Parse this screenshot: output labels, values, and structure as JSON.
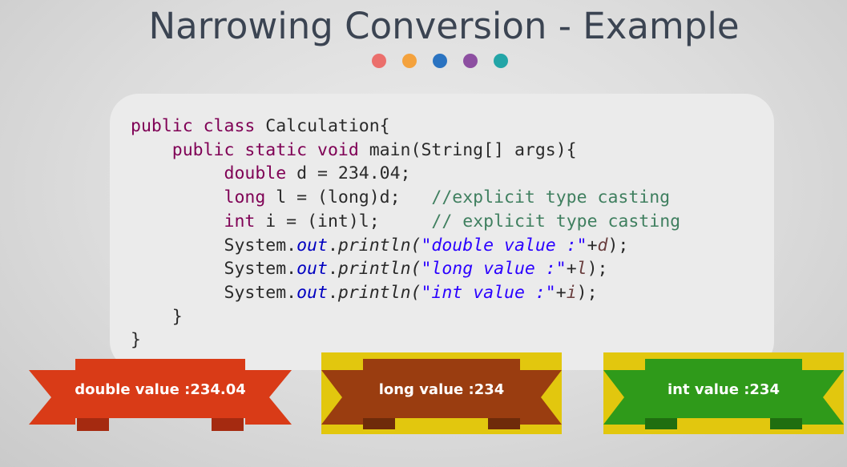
{
  "slide": {
    "title": "Narrowing Conversion - Example",
    "dot_colors": [
      "#eb6f6c",
      "#f4a23d",
      "#2a73c1",
      "#8d4fa1",
      "#23a5a7"
    ]
  },
  "code": {
    "line1": {
      "kw": "public class",
      "rest": " Calculation{"
    },
    "line2": {
      "kw": "public static void",
      "rest": " main(String[] args){"
    },
    "line3": {
      "kw": "double",
      "rest": " d = 234.04;"
    },
    "line4": {
      "kw": "long",
      "rest": " l = (long)d;",
      "comment": "//explicit type casting"
    },
    "line5": {
      "kw": "int",
      "rest": " i = (int)l;",
      "comment": "// explicit type casting"
    },
    "line6": {
      "obj": "System.",
      "field": "out",
      "dot": ".",
      "method": "println(",
      "str": "\"double value :\"",
      "plus": "+",
      "var": "d",
      "end": ");"
    },
    "line7": {
      "obj": "System.",
      "field": "out",
      "dot": ".",
      "method": "println(",
      "str": "\"long value :\"",
      "plus": "+",
      "var": "l",
      "end": ");"
    },
    "line8": {
      "obj": "System.",
      "field": "out",
      "dot": ".",
      "method": "println(",
      "str": "\"int value :\"",
      "plus": "+",
      "var": "i",
      "end": ");"
    },
    "line9": "}",
    "line10": "}"
  },
  "outputs": [
    {
      "label": "double value :234.04",
      "ribbon_color": "#d93b17",
      "shade_color": "#a52a10",
      "backing_color": null
    },
    {
      "label": "long value :234",
      "ribbon_color": "#9a3d10",
      "shade_color": "#6f2b0a",
      "backing_color": "#e2c70e"
    },
    {
      "label": "int value :234",
      "ribbon_color": "#2f9a1a",
      "shade_color": "#1f6e10",
      "backing_color": "#e2c70e"
    }
  ]
}
